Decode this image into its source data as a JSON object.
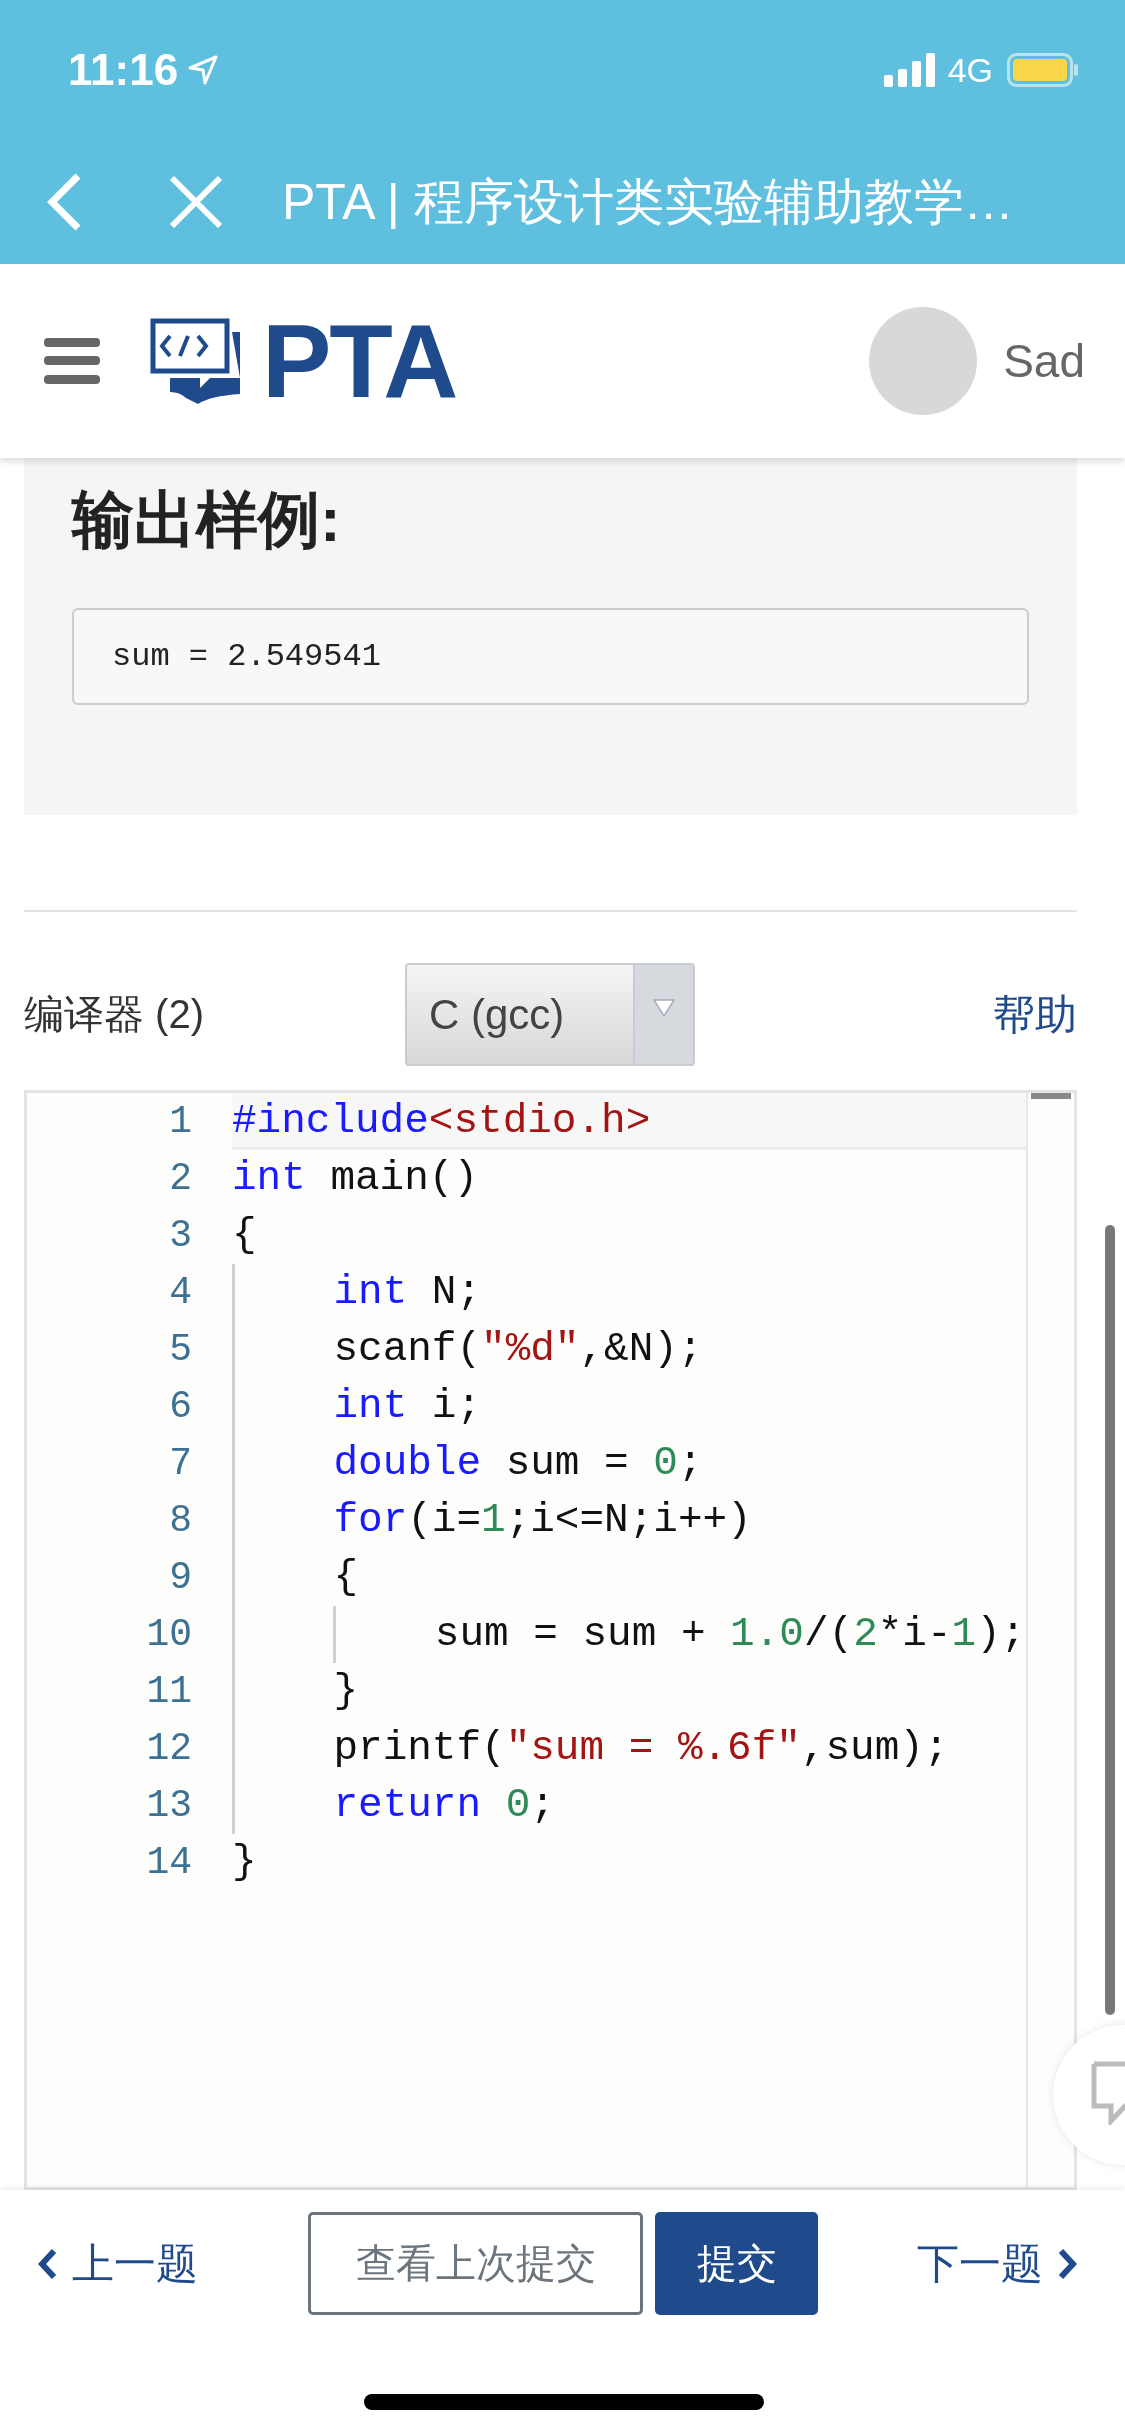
{
  "status_bar": {
    "time": "11:16",
    "network": "4G"
  },
  "browser_bar": {
    "title": "PTA | 程序设计类实验辅助教学…"
  },
  "header": {
    "logo_text": "PTA",
    "user_name": "Sad"
  },
  "sample_output": {
    "heading": "输出样例:",
    "value": "sum = 2.549541"
  },
  "compiler": {
    "label": "编译器 (2)",
    "selected_value": "C (gcc)",
    "help_link": "帮助"
  },
  "editor": {
    "lines": [
      {
        "number": "1",
        "tokens": [
          {
            "kind": "keyword",
            "text": "#include"
          },
          {
            "kind": "string",
            "text": "<stdio.h>"
          }
        ]
      },
      {
        "number": "2",
        "tokens": [
          {
            "kind": "keyword",
            "text": "int"
          },
          {
            "kind": "plain",
            "text": " main()"
          }
        ]
      },
      {
        "number": "3",
        "tokens": [
          {
            "kind": "plain",
            "text": "{"
          }
        ]
      },
      {
        "number": "4",
        "tokens": [
          {
            "kind": "keyword",
            "text": "    int"
          },
          {
            "kind": "plain",
            "text": " N;"
          }
        ]
      },
      {
        "number": "5",
        "tokens": [
          {
            "kind": "plain",
            "text": "    scanf("
          },
          {
            "kind": "string",
            "text": "\"%d\""
          },
          {
            "kind": "plain",
            "text": ",&N);"
          }
        ]
      },
      {
        "number": "6",
        "tokens": [
          {
            "kind": "keyword",
            "text": "    int"
          },
          {
            "kind": "plain",
            "text": " i;"
          }
        ]
      },
      {
        "number": "7",
        "tokens": [
          {
            "kind": "keyword",
            "text": "    double"
          },
          {
            "kind": "plain",
            "text": " sum = "
          },
          {
            "kind": "number",
            "text": "0"
          },
          {
            "kind": "plain",
            "text": ";"
          }
        ]
      },
      {
        "number": "8",
        "tokens": [
          {
            "kind": "keyword",
            "text": "    for"
          },
          {
            "kind": "plain",
            "text": "(i="
          },
          {
            "kind": "number",
            "text": "1"
          },
          {
            "kind": "plain",
            "text": ";i<=N;i++)"
          }
        ]
      },
      {
        "number": "9",
        "tokens": [
          {
            "kind": "plain",
            "text": "    {"
          }
        ]
      },
      {
        "number": "10",
        "tokens": [
          {
            "kind": "plain",
            "text": "        sum = sum + "
          },
          {
            "kind": "number",
            "text": "1.0"
          },
          {
            "kind": "plain",
            "text": "/("
          },
          {
            "kind": "number",
            "text": "2"
          },
          {
            "kind": "plain",
            "text": "*i-"
          },
          {
            "kind": "number",
            "text": "1"
          },
          {
            "kind": "plain",
            "text": ");"
          }
        ]
      },
      {
        "number": "11",
        "tokens": [
          {
            "kind": "plain",
            "text": "    }"
          }
        ]
      },
      {
        "number": "12",
        "tokens": [
          {
            "kind": "plain",
            "text": "    printf("
          },
          {
            "kind": "string",
            "text": "\"sum = %.6f\""
          },
          {
            "kind": "plain",
            "text": ",sum);"
          }
        ]
      },
      {
        "number": "13",
        "tokens": [
          {
            "kind": "keyword",
            "text": "    return"
          },
          {
            "kind": "number",
            "text": " 0"
          },
          {
            "kind": "plain",
            "text": ";"
          }
        ]
      },
      {
        "number": "14",
        "tokens": [
          {
            "kind": "plain",
            "text": "}"
          }
        ]
      }
    ]
  },
  "bottom_bar": {
    "previous": "上一题",
    "view_last": "查看上次提交",
    "submit": "提交",
    "next": "下一题"
  }
}
